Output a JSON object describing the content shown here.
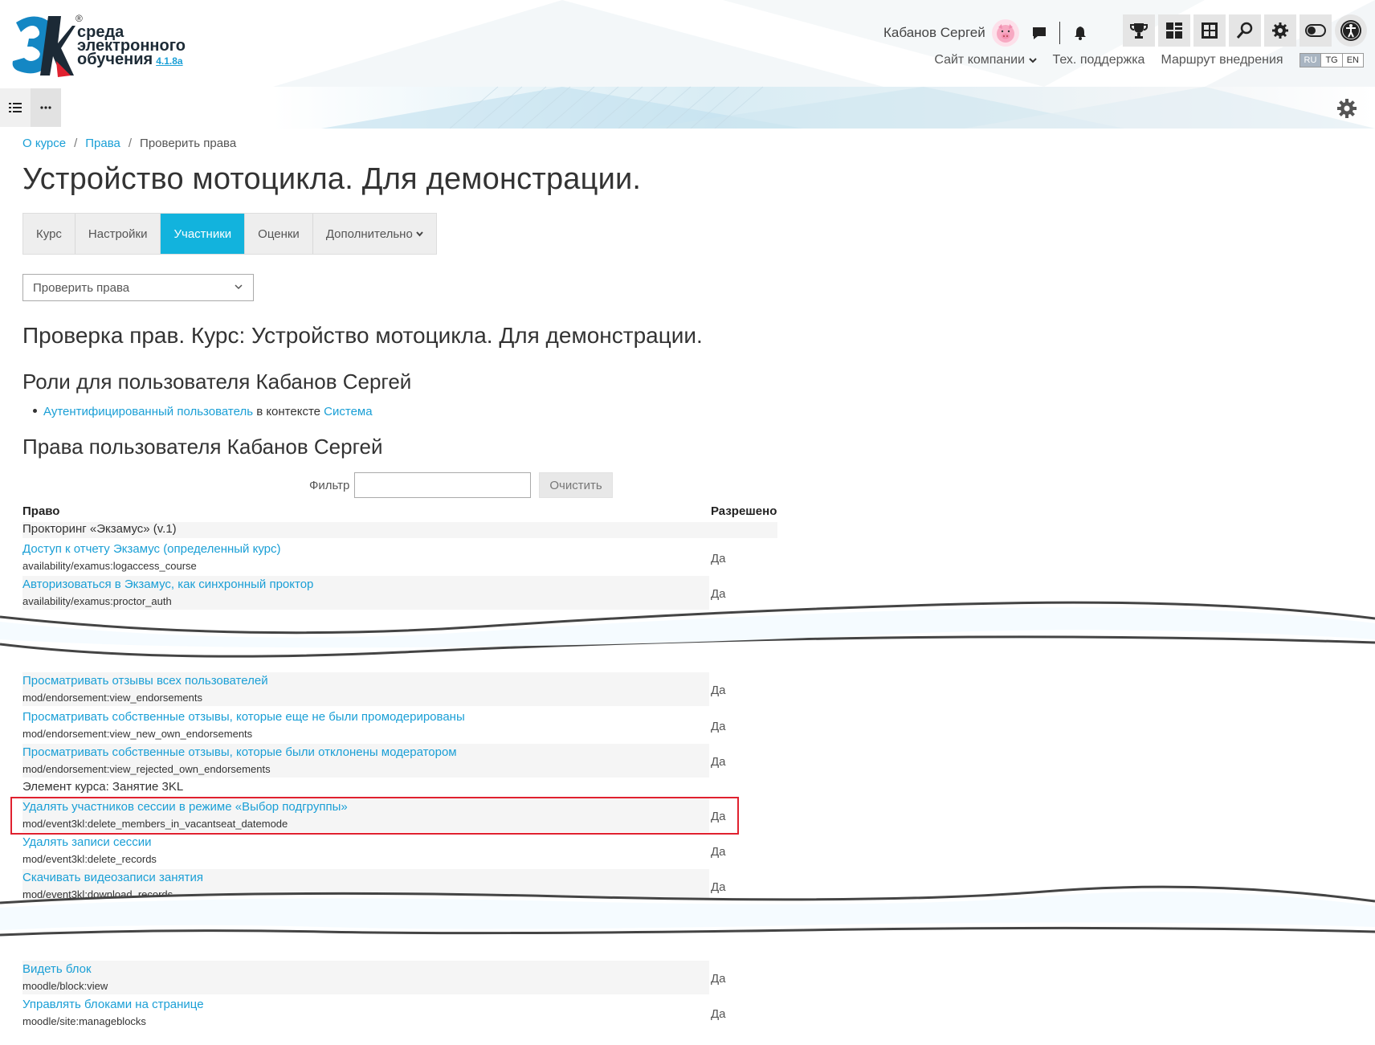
{
  "header": {
    "logo_lines": [
      "среда",
      "электронного",
      "обучения"
    ],
    "logo_version": "4.1.8а",
    "logo_reg": "®",
    "user_name": "Кабанов Сергей",
    "links": [
      "Сайт компании",
      "Тех. поддержка",
      "Маршрут внедрения"
    ],
    "languages": [
      "RU",
      "TG",
      "EN"
    ],
    "colors": {
      "accent": "#12b3dd",
      "link": "#1a9fd6",
      "highlight": "#e0212f"
    }
  },
  "breadcrumb": [
    "О курсе",
    "Права",
    "Проверить права"
  ],
  "page_title": "Устройство мотоцикла. Для демонстрации.",
  "tabs": [
    "Курс",
    "Настройки",
    "Участники",
    "Оценки",
    "Дополнительно"
  ],
  "active_tab": "Участники",
  "select_value": "Проверить права",
  "check_title": "Проверка прав. Курс: Устройство мотоцикла. Для демонстрации.",
  "roles_title": "Роли для пользователя Кабанов Сергей",
  "role": {
    "name": "Аутентифицированный пользователь",
    "context_text": "в контексте",
    "context": "Система"
  },
  "rights_title": "Права пользователя Кабанов Сергей",
  "filter": {
    "label": "Фильтр",
    "value": "",
    "clear_label": "Очистить"
  },
  "table": {
    "col_right": "Право",
    "col_allowed": "Разрешено",
    "section1": "Прокторинг «Экзамус» (v.1)",
    "rows_a": [
      {
        "name": "Доступ к отчету Экзамус (определенный курс)",
        "cap": "availability/examus:logaccess_course",
        "val": "Да"
      },
      {
        "name": "Авторизоваться в Экзамус, как синхронный проктор",
        "cap": "availability/examus:proctor_auth",
        "val": "Да"
      }
    ],
    "rows_b": [
      {
        "name": "Просматривать отзывы всех пользователей",
        "cap": "mod/endorsement:view_endorsements",
        "val": "Да"
      },
      {
        "name": "Просматривать собственные отзывы, которые еще не были промодерированы",
        "cap": "mod/endorsement:view_new_own_endorsements",
        "val": "Да"
      },
      {
        "name": "Просматривать собственные отзывы, которые были отклонены модератором",
        "cap": "mod/endorsement:view_rejected_own_endorsements",
        "val": "Да"
      }
    ],
    "section2": "Элемент курса: Занятие 3KL",
    "rows_c": [
      {
        "name": "Удалять участников сессии в режиме «Выбор подгруппы»",
        "cap": "mod/event3kl:delete_members_in_vacantseat_datemode",
        "val": "Да"
      },
      {
        "name": "Удалять записи сессии",
        "cap": "mod/event3kl:delete_records",
        "val": "Да"
      },
      {
        "name": "Скачивать видеозаписи занятия",
        "cap": "mod/event3kl:download_records",
        "val": "Да"
      }
    ],
    "rows_d": [
      {
        "name": "Видеть блок",
        "cap": "moodle/block:view",
        "val": "Да"
      },
      {
        "name": "Управлять блоками на странице",
        "cap": "moodle/site:manageblocks",
        "val": "Да"
      }
    ]
  }
}
